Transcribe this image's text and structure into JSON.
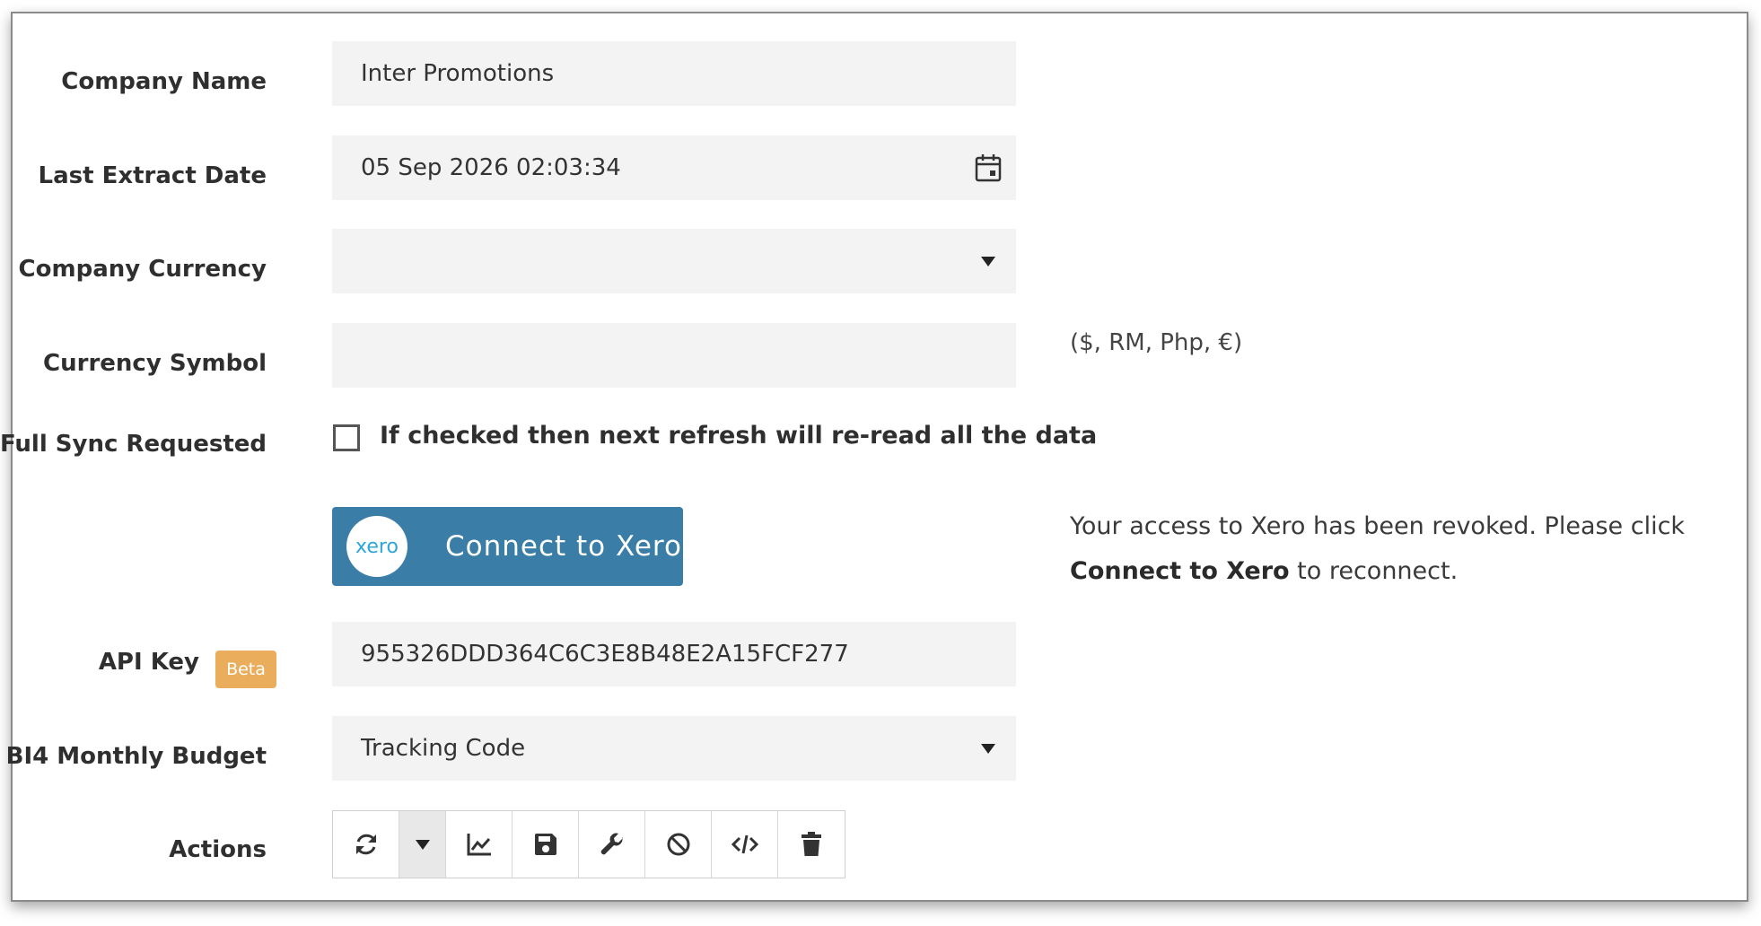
{
  "form": {
    "company_name": {
      "label": "Company Name",
      "value": "Inter Promotions"
    },
    "last_extract_date": {
      "label": "Last Extract Date",
      "value": "05 Sep 2026 02:03:34"
    },
    "company_currency": {
      "label": "Company Currency",
      "value": ""
    },
    "currency_symbol": {
      "label": "Currency Symbol",
      "value": "",
      "hint": "($, RM, Php, €)"
    },
    "full_sync": {
      "label": "Full Sync Requested",
      "checked": false,
      "checkbox_label": "If checked then next refresh will re-read all the data"
    },
    "xero": {
      "button_label": "Connect to Xero",
      "logo_text": "xero",
      "message_pre": "Your access to Xero has been revoked. Please click ",
      "message_bold": "Connect to Xero",
      "message_post": " to reconnect."
    },
    "api_key": {
      "label": "API Key",
      "badge": "Beta",
      "value": "955326DDD364C6C3E8B48E2A15FCF277"
    },
    "bi4_budget": {
      "label": "BI4 Monthly Budget",
      "value": "Tracking Code"
    },
    "actions": {
      "label": "Actions",
      "buttons": [
        "refresh-icon",
        "chevron-down-icon",
        "chart-line-icon",
        "save-icon",
        "wrench-icon",
        "ban-icon",
        "code-icon",
        "trash-icon"
      ]
    }
  },
  "colors": {
    "xero_button": "#3a7da6",
    "beta_badge": "#e9ad5b",
    "field_bg": "#f3f3f3"
  }
}
